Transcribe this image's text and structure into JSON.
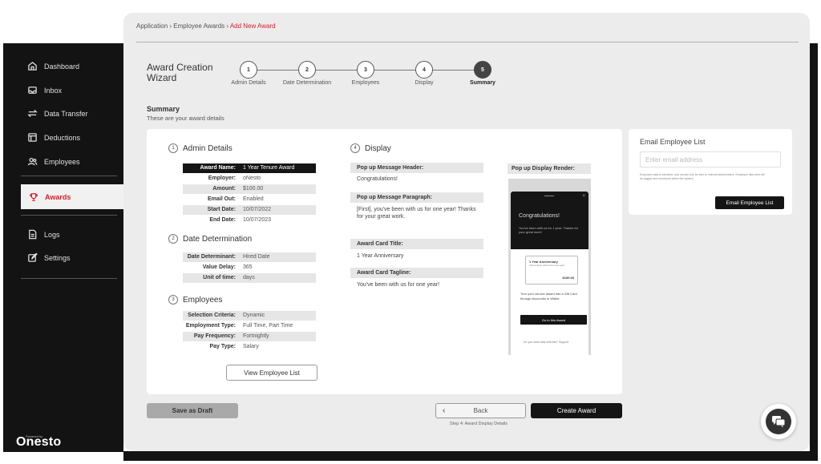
{
  "brand": {
    "powered_by": "Powered by",
    "name": "Onesto"
  },
  "sidebar": {
    "items": [
      {
        "label": "Dashboard",
        "icon": "home-icon"
      },
      {
        "label": "Inbox",
        "icon": "inbox-icon"
      },
      {
        "label": "Data Transfer",
        "icon": "transfer-icon"
      },
      {
        "label": "Deductions",
        "icon": "deductions-icon"
      },
      {
        "label": "Employees",
        "icon": "employees-icon"
      },
      {
        "label": "Awards",
        "icon": "trophy-icon",
        "active": true
      },
      {
        "label": "Logs",
        "icon": "logs-icon"
      },
      {
        "label": "Settings",
        "icon": "settings-icon"
      }
    ]
  },
  "breadcrumb": {
    "part1": "Application",
    "sep": " › ",
    "part2": "Employee Awards",
    "current": "Add New Award"
  },
  "wizard": {
    "title": "Award Creation Wizard",
    "steps": [
      {
        "num": "1",
        "label": "Admin Details"
      },
      {
        "num": "2",
        "label": "Date Determination"
      },
      {
        "num": "3",
        "label": "Employees"
      },
      {
        "num": "4",
        "label": "Display"
      },
      {
        "num": "5",
        "label": "Summary",
        "active": true
      }
    ]
  },
  "summary": {
    "title": "Summary",
    "subtitle": "These are your award details"
  },
  "admin": {
    "num": "1",
    "title": "Admin Details",
    "rows": [
      {
        "k": "Award Name:",
        "v": "1 Year Tenure Award"
      },
      {
        "k": "Employer:",
        "v": "oNesto"
      },
      {
        "k": "Amount:",
        "v": "$100.00"
      },
      {
        "k": "Email Out:",
        "v": "Enabled"
      },
      {
        "k": "Start Date:",
        "v": "10/07/2022"
      },
      {
        "k": "End Date:",
        "v": "10/07/2023"
      }
    ]
  },
  "date": {
    "num": "2",
    "title": "Date Determination",
    "rows": [
      {
        "k": "Date Determinant:",
        "v": "Hired Date"
      },
      {
        "k": "Value Delay:",
        "v": "365"
      },
      {
        "k": "Unit of time:",
        "v": "days"
      }
    ]
  },
  "employees": {
    "num": "3",
    "title": "Employees",
    "rows": [
      {
        "k": "Selection Criteria:",
        "v": "Dynamic"
      },
      {
        "k": "Employment Type:",
        "v": "Full Time, Part Time"
      },
      {
        "k": "Pay Frequency:",
        "v": "Fortnightly"
      },
      {
        "k": "Pay Type:",
        "v": "Salary"
      }
    ],
    "view_button": "View Employee List"
  },
  "display": {
    "num": "4",
    "title": "Display",
    "header_label": "Pop up Message Header:",
    "header_value": "Congratulations!",
    "paragraph_label": "Pop up Message Paragraph:",
    "paragraph_value": "[First], you've been with us for one year! Thanks for your great work.",
    "card_title_label": "Award Card Title:",
    "card_title_value": "1 Year Anniversary",
    "card_tagline_label": "Award Card Tagline:",
    "card_tagline_value": "You've been with us for one year!",
    "render_label": "Pop up Display Render:"
  },
  "popup": {
    "close": "×",
    "title": "Congratulations!",
    "paragraph": "You've been with us for 1 year. Thanks for your great work!",
    "card_title": "1 Year Anniversary",
    "card_sub": "You've been with us for one year!",
    "card_amount": "$100.00",
    "text": "Turn your service award into a Gift Card through Accountio in Wallet.",
    "button": "Go to this Award",
    "help": "Do you need help with this? Support"
  },
  "email": {
    "title": "Email Employee List",
    "placeholder": "Enter email address",
    "note": "Employee data is sensitive, and should only be sent to internal stakeholders. Employee lists sent will be logged and monitored within the system.",
    "button": "Email Employee List"
  },
  "footer": {
    "draft": "Save as Draft",
    "back": "Back",
    "create": "Create Award",
    "step_note": "Step 4: Award Display Details"
  }
}
